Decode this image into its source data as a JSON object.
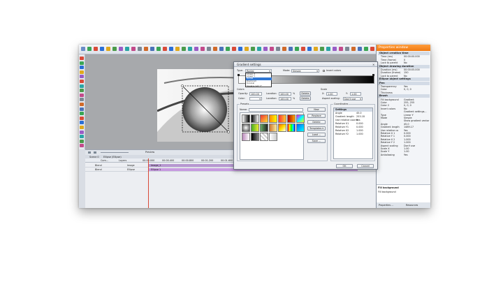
{
  "toolbar": {
    "icon_colors": [
      "#6a8cc7",
      "#3aa655",
      "#d94a38",
      "#2a6fd6",
      "#e0a91d",
      "#4b9b4b",
      "#9a5cc6",
      "#2aa5a5",
      "#c34a8a",
      "#7b8794",
      "#d06a2a",
      "#4a72b8",
      "#3aa655",
      "#d94a38",
      "#2a6fd6",
      "#e0a91d",
      "#4b9b4b",
      "#2aa5a5",
      "#9a5cc6",
      "#c34a8a",
      "#7b8794",
      "#d06a2a",
      "#4a72b8",
      "#3aa655",
      "#d94a38",
      "#2a6fd6",
      "#e0a91d",
      "#4b9b4b",
      "#2aa5a5",
      "#9a5cc6",
      "#c34a8a",
      "#7b8794",
      "#d06a2a",
      "#4a72b8",
      "#3aa655",
      "#d94a38",
      "#2a6fd6",
      "#e0a91d",
      "#4b9b4b",
      "#2aa5a5",
      "#9a5cc6",
      "#c34a8a",
      "#7b8794",
      "#d06a2a",
      "#4a72b8",
      "#3aa655",
      "#d94a38"
    ]
  },
  "lefttools": {
    "icon_colors": [
      "#d94a38",
      "#3aa655",
      "#2a6fd6",
      "#e0a91d",
      "#9a5cc6",
      "#d94a38",
      "#2aa5a5",
      "#4b9b4b",
      "#c34a8a",
      "#7b8794",
      "#d06a2a",
      "#4a72b8",
      "#3aa655",
      "#d94a38",
      "#2a6fd6",
      "#e0a91d",
      "#9a5cc6",
      "#2aa5a5",
      "#4b9b4b",
      "#c34a8a"
    ]
  },
  "timeline": {
    "preview_label": "Preview",
    "tabs": [
      "Scene 0",
      "Ellipse (Ellipse)"
    ],
    "ruler": [
      "00:00.000",
      "00:00.400",
      "00:00.800",
      "00:01.200",
      "00:01.600",
      "00:02.000",
      "00:02.400"
    ],
    "col_com": "Com...",
    "col_layers": "Layers",
    "rows": [
      {
        "blend": "Blend",
        "name": "Image",
        "clip": "Image_1",
        "color": "#b797d1"
      },
      {
        "blend": "Blend",
        "name": "Ellipse",
        "clip": "Ellipse 1",
        "color": "#c79ae0"
      }
    ]
  },
  "properties": {
    "title": "Properties window",
    "sections": [
      {
        "title": "Object creation time",
        "rows": [
          [
            "Time (ms)",
            "00:00:00.000"
          ],
          [
            "Time (frame)",
            "0"
          ],
          [
            "Lock to parent",
            "No"
          ]
        ]
      },
      {
        "title": "Object drawing duration",
        "rows": [
          [
            "Duration (ms)",
            "00:00:05.000"
          ],
          [
            "Duration (frame)",
            "150"
          ],
          [
            "Lock to parent",
            "No"
          ]
        ]
      },
      {
        "title": "Ellipse object settings",
        "rows": []
      },
      {
        "title": "Pen",
        "rows": [
          [
            "Transparency",
            "Yes"
          ],
          [
            "Color",
            "0, 0, 0"
          ],
          [
            "Thickness",
            ""
          ]
        ]
      },
      {
        "title": "Brush",
        "rows": [
          [
            "Fill background",
            "Gradient"
          ],
          [
            "Color",
            "255, 255"
          ],
          [
            "Color 2",
            "0, 0, 0"
          ],
          [
            "Invert colors",
            "No"
          ],
          [
            "",
            "Gradient settings..."
          ],
          [
            "Type",
            "Linear Y"
          ],
          [
            "Mode",
            "Simple"
          ],
          [
            "",
            "Show gradient vector"
          ],
          [
            "Angle",
            "45.0"
          ],
          [
            "Gradient length",
            "1489.17"
          ],
          [
            "Use relative co",
            "Yes"
          ],
          [
            "Relative X 1",
            "0.000"
          ],
          [
            "Relative Y 1",
            "0.000"
          ],
          [
            "Relative X 2",
            "1.000"
          ],
          [
            "Relative Y 2",
            "1.000"
          ],
          [
            "Aspect scaling",
            "Don't use"
          ],
          [
            "Scale X",
            "1.00"
          ],
          [
            "Scale Y",
            "1.00"
          ],
          [
            "Antialiasing",
            "Yes"
          ]
        ]
      }
    ],
    "desc_title": "Fill background",
    "desc_text": "Fill background",
    "footer_tabs": [
      "Properties ...",
      "Resources"
    ]
  },
  "dialog": {
    "title": "Gradient settings",
    "type_label": "Type:",
    "type_value": "Radial",
    "type_options": [
      "Linear X",
      "Linear Y",
      "Radial",
      "Diamond",
      "Conical",
      "Square root Y*"
    ],
    "type_selected": 2,
    "mode_label": "Mode:",
    "mode_value": "Simple",
    "invert_label": "Invert colors",
    "colors_label": "Colors",
    "opacity_label": "Opacity:",
    "color_label": "Color:",
    "location_label": "Location:",
    "opacity_val": "100.00",
    "loc_val1": "100.00",
    "loc_val2": "100.00",
    "pct": "%",
    "delete": "Delete",
    "scale_label": "Scale",
    "sx_label": "X:",
    "sx_val": "1.00",
    "sy_label": "Y:",
    "sy_val": "1.00",
    "aspect_label": "Aspect scaling:",
    "aspect_val": "Don't use",
    "presets_label": "Presets",
    "name_label": "Name:",
    "preset_buttons": [
      "New",
      "Replace",
      "Delete",
      "Templates ▾",
      "Load ...",
      "Save ..."
    ],
    "coords_label": "Coordinates",
    "settings_head": "Settings",
    "settings": [
      [
        "Angle",
        "45.0"
      ],
      [
        "Gradient length",
        "253.18"
      ],
      [
        "Use relative coords",
        "Yes"
      ],
      [
        "Relative X1",
        "0.000"
      ],
      [
        "Relative Y1",
        "0.000"
      ],
      [
        "Relative X2",
        "1.000"
      ],
      [
        "Relative Y2",
        "1.000"
      ]
    ],
    "ok": "OK",
    "cancel": "Cancel"
  }
}
